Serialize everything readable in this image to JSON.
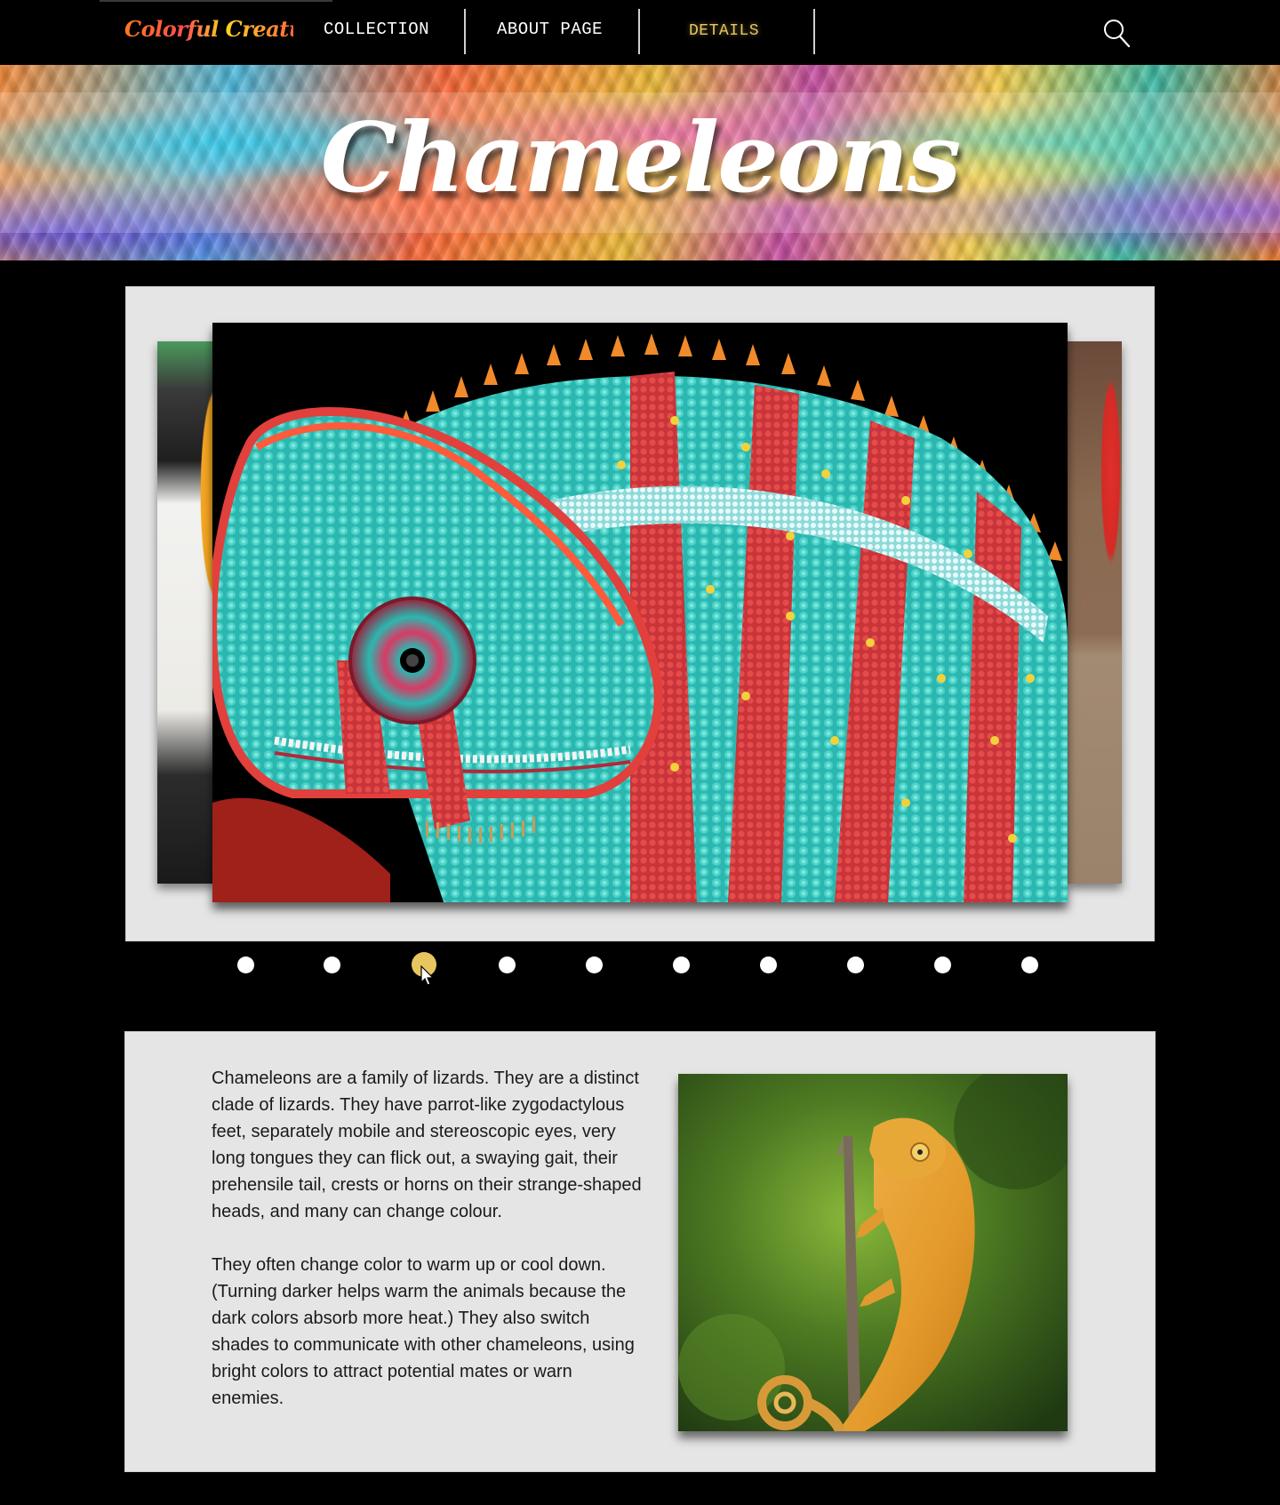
{
  "nav": {
    "logo_text": "Colorful Creatures",
    "items": [
      {
        "label": "COLLECTION"
      },
      {
        "label": "ABOUT PAGE"
      },
      {
        "label": "DETAILS"
      }
    ],
    "active_item": "DETAILS",
    "search_icon": "search-icon",
    "accent_color": "#e8c65f"
  },
  "hero": {
    "title": "Chameleons"
  },
  "slider": {
    "main_image": "panther chameleon illustration (turquoise and red scales)",
    "left_peek_image": "toucan",
    "right_peek_image": "red-headed lizard",
    "dot_count": 10,
    "active_dot": 3
  },
  "info": {
    "paragraphs": [
      "Chameleons are a family of lizards. They are a distinct clade of lizards. They have parrot-like zygodactylous feet, separately mobile and stereoscopic eyes, very long tongues they can flick out, a swaying gait, their prehensile tail, crests or horns on their strange-shaped heads, and many can change colour.",
      "They often change color to warm up or cool down. (Turning darker helps warm the animals because the dark colors absorb more heat.) They also switch shades to communicate with other chameleons, using bright colors to attract potential mates or warn enemies."
    ],
    "photo": "orange chameleon on a branch"
  }
}
